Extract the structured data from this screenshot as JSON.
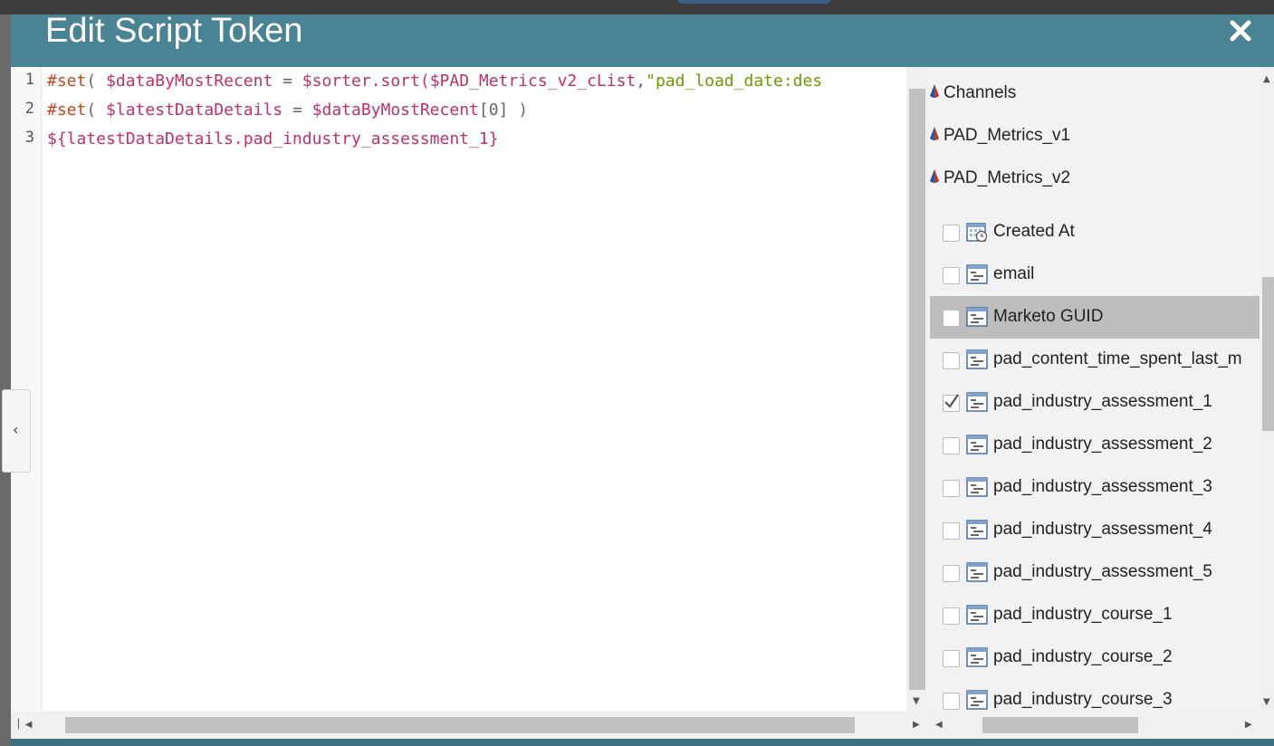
{
  "dialog": {
    "title": "Edit Script Token",
    "accent": "#4a8394"
  },
  "editor": {
    "line_numbers": [
      "1",
      "2",
      "3"
    ],
    "lines": [
      [
        {
          "t": "#set",
          "c": "kw"
        },
        {
          "t": "( ",
          "c": "pl"
        },
        {
          "t": "$dataByMostRecent",
          "c": "var"
        },
        {
          "t": " = ",
          "c": "pl"
        },
        {
          "t": "$sorter.sort(",
          "c": "var"
        },
        {
          "t": "$PAD_Metrics_v2_cList",
          "c": "var"
        },
        {
          "t": ",",
          "c": "pl"
        },
        {
          "t": "\"pad_load_date:des",
          "c": "str"
        }
      ],
      [
        {
          "t": "#set",
          "c": "kw"
        },
        {
          "t": "( ",
          "c": "pl"
        },
        {
          "t": "$latestDataDetails",
          "c": "var"
        },
        {
          "t": " = ",
          "c": "pl"
        },
        {
          "t": "$dataByMostRecent",
          "c": "var"
        },
        {
          "t": "[0] )",
          "c": "pl"
        }
      ],
      [
        {
          "t": "${latestDataDetails.pad_industry_assessment_1}",
          "c": "var"
        }
      ]
    ]
  },
  "tree": {
    "objects": [
      "Channels",
      "PAD_Metrics_v1",
      "PAD_Metrics_v2"
    ],
    "fields": [
      {
        "label": "Created At",
        "checked": false,
        "icon": "calendar-icon"
      },
      {
        "label": "email",
        "checked": false,
        "icon": "field-icon"
      },
      {
        "label": "Marketo GUID",
        "checked": false,
        "icon": "field-icon",
        "selected": true
      },
      {
        "label": "pad_content_time_spent_last_m",
        "checked": false,
        "icon": "field-icon"
      },
      {
        "label": "pad_industry_assessment_1",
        "checked": true,
        "icon": "field-icon"
      },
      {
        "label": "pad_industry_assessment_2",
        "checked": false,
        "icon": "field-icon"
      },
      {
        "label": "pad_industry_assessment_3",
        "checked": false,
        "icon": "field-icon"
      },
      {
        "label": "pad_industry_assessment_4",
        "checked": false,
        "icon": "field-icon"
      },
      {
        "label": "pad_industry_assessment_5",
        "checked": false,
        "icon": "field-icon"
      },
      {
        "label": "pad_industry_course_1",
        "checked": false,
        "icon": "field-icon"
      },
      {
        "label": "pad_industry_course_2",
        "checked": false,
        "icon": "field-icon"
      },
      {
        "label": "pad_industry_course_3",
        "checked": false,
        "icon": "field-icon"
      }
    ]
  },
  "icons": {
    "close": "close-icon",
    "collapse": "chevron-left-icon",
    "object": "custom-object-icon"
  }
}
